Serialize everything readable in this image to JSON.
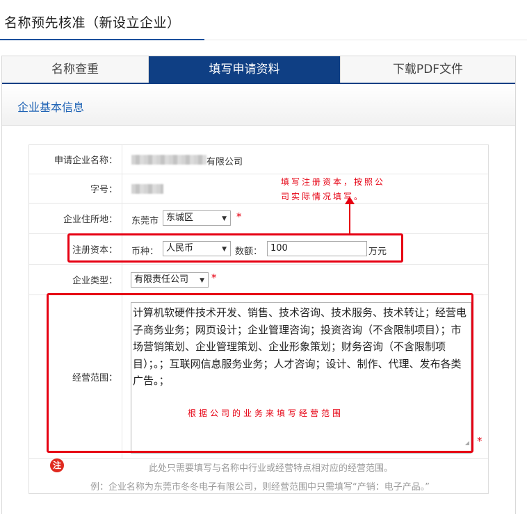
{
  "page_title": "名称预先核准（新设立企业）",
  "tabs": [
    {
      "label": "名称查重",
      "active": false
    },
    {
      "label": "填写申请资料",
      "active": true
    },
    {
      "label": "下载PDF文件",
      "active": false
    }
  ],
  "section_title": "企业基本信息",
  "form": {
    "company_name": {
      "label": "申请企业名称：",
      "value_suffix": "有限公司"
    },
    "trade_name": {
      "label": "字号："
    },
    "address": {
      "label": "企业住所地：",
      "city": "东莞市",
      "district": "东城区",
      "required": "*"
    },
    "capital": {
      "label": "注册资本：",
      "currency_label": "币种：",
      "currency": "人民币",
      "amount_label": "数额：",
      "amount": "100",
      "unit": "万元",
      "required": "*"
    },
    "company_type": {
      "label": "企业类型：",
      "value": "有限责任公司",
      "required": "*"
    },
    "business_scope": {
      "label": "经营范围：",
      "value": "计算机软硬件技术开发、销售、技术咨询、技术服务、技术转让；经营电子商务业务；网页设计；企业管理咨询；投资咨询（不含限制项目）；市场营销策划、企业管理策划、企业形象策划；财务咨询（不含限制项目）；。；互联网信息服务业务；人才咨询；设计、制作、代理、发布各类广告。；",
      "required": "*"
    }
  },
  "annotations": {
    "capital_hint_line1": "填写注册资本，按照公",
    "capital_hint_line2": "司实际情况填写。",
    "scope_hint": "根据公司的业务来填写经营范围"
  },
  "notes": {
    "badge": "注",
    "line1": "此处只需要填写与名称中行业或经营特点相对应的经营范围。",
    "line2": "例：企业名称为东莞市冬冬电子有限公司，则经营范围中只需填写“产销：电子产品。”"
  },
  "colors": {
    "accent_blue": "#0f3f84",
    "title_blue": "#1f63b5",
    "highlight_red": "#e60012"
  }
}
